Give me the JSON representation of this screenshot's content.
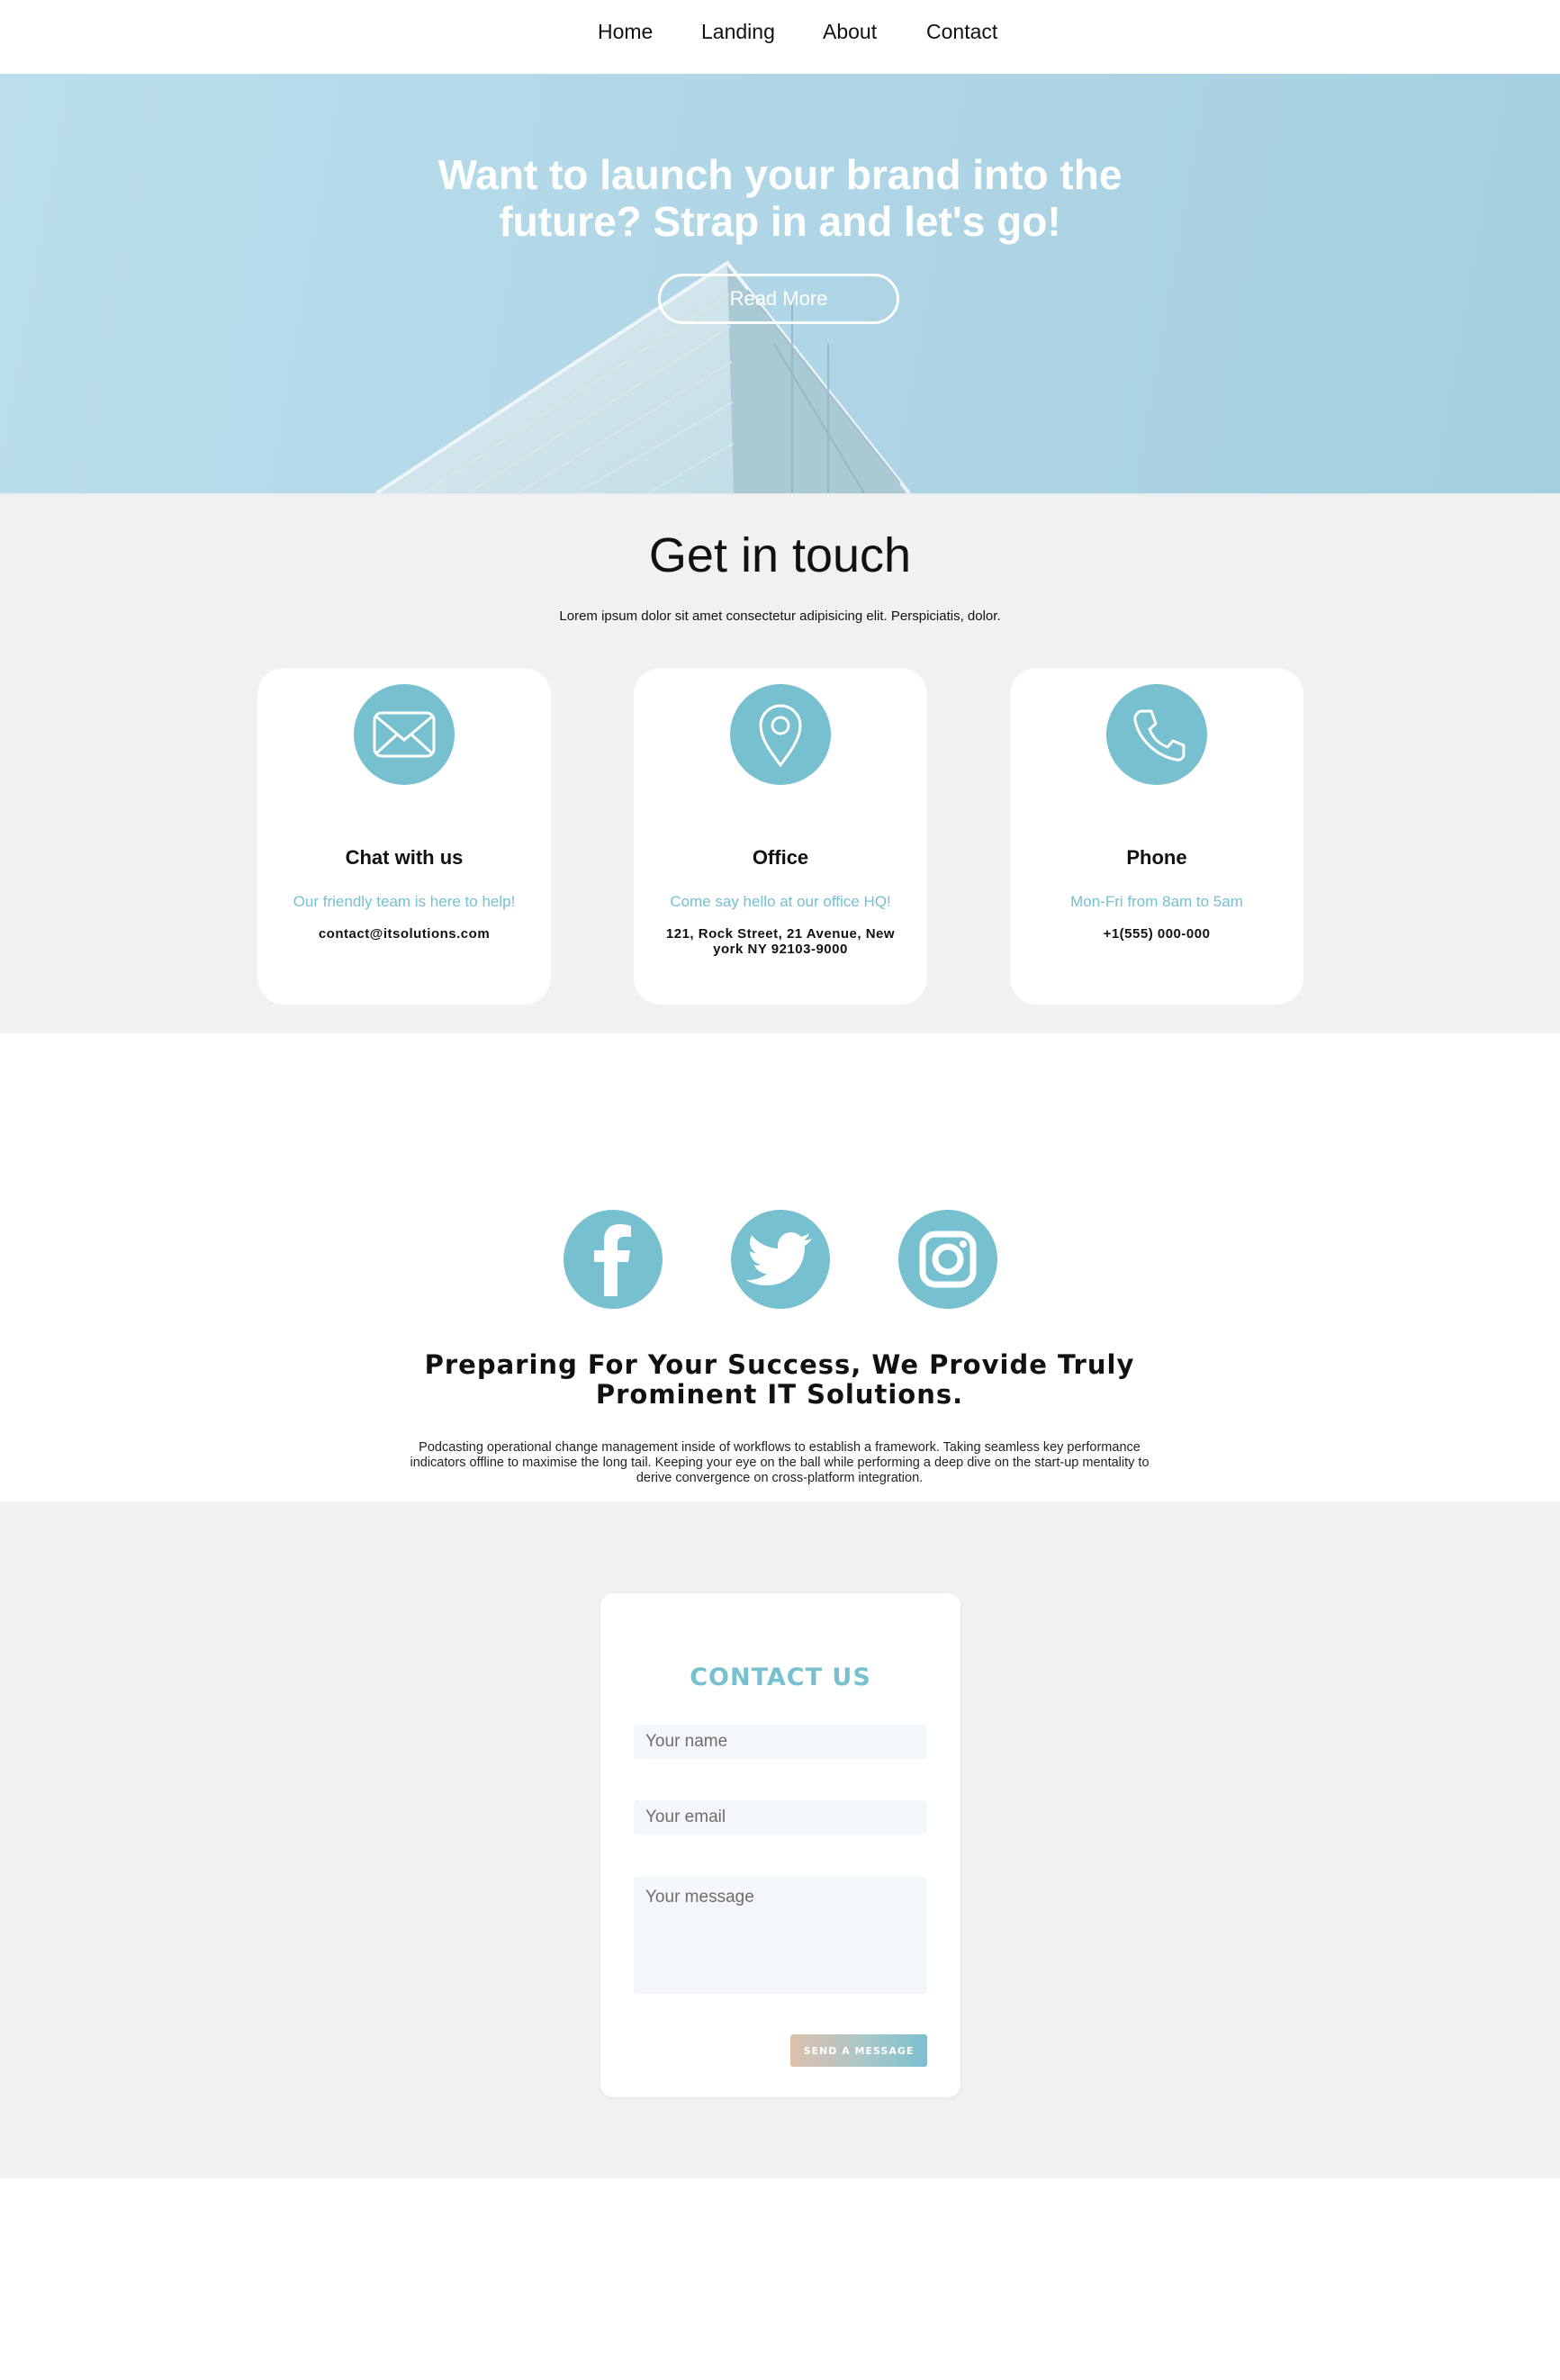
{
  "nav": {
    "items": [
      {
        "label": "Home"
      },
      {
        "label": "Landing"
      },
      {
        "label": "About"
      },
      {
        "label": "Contact"
      }
    ]
  },
  "hero": {
    "title_line1": "Want to launch your brand into the",
    "title_line2": "future? Strap in and let's go!",
    "button_label": "Read More"
  },
  "touch": {
    "title": "Get in touch",
    "subtitle": "Lorem ipsum dolor sit amet consectetur adipisicing elit. Perspiciatis, dolor.",
    "cards": [
      {
        "icon": "envelope-icon",
        "title": "Chat with us",
        "desc": "Our friendly team is here to help!",
        "value": "contact@itsolutions.com"
      },
      {
        "icon": "location-pin-icon",
        "title": "Office",
        "desc": "Come say hello at our office HQ!",
        "value": "121, Rock Street, 21 Avenue, New york NY 92103-9000"
      },
      {
        "icon": "phone-icon",
        "title": "Phone",
        "desc": "Mon-Fri from 8am to 5am",
        "value": "+1(555) 000-000"
      }
    ]
  },
  "social": {
    "icons": [
      "facebook-icon",
      "twitter-icon",
      "instagram-icon"
    ],
    "title_line1": "Preparing For Your Success, We Provide Truly",
    "title_line2": "Prominent IT Solutions.",
    "text": "Podcasting operational change management inside of workflows to establish a framework. Taking seamless key performance indicators offline to maximise the long tail. Keeping your eye on the ball while performing a deep dive on the start-up mentality to derive convergence on cross-platform integration."
  },
  "contact_form": {
    "title": "CONTACT US",
    "name_placeholder": "Your name",
    "email_placeholder": "Your email",
    "message_placeholder": "Your message",
    "send_label": "SEND A MESSAGE"
  },
  "colors": {
    "accent": "#76c0d0",
    "section_bg": "#f1f1f1",
    "hero_sky": "#b1d7e7"
  }
}
